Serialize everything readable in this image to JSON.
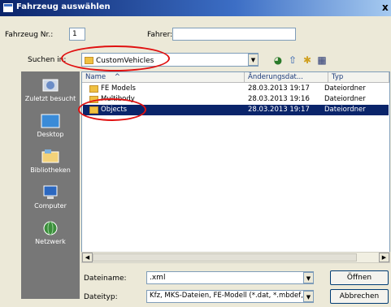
{
  "window": {
    "title": "Fahrzeug auswählen",
    "close_glyph": "x"
  },
  "form": {
    "vehicle_no_label": "Fahrzeug Nr.:",
    "vehicle_no_value": "1",
    "driver_label": "Fahrer:",
    "driver_value": "",
    "search_in_label": "Suchen in:",
    "search_in_value": "CustomVehicles"
  },
  "places": [
    {
      "label": "Zuletzt besucht",
      "icon": "recent-icon"
    },
    {
      "label": "Desktop",
      "icon": "desktop-icon"
    },
    {
      "label": "Bibliotheken",
      "icon": "libraries-icon"
    },
    {
      "label": "Computer",
      "icon": "computer-icon"
    },
    {
      "label": "Netzwerk",
      "icon": "network-icon"
    }
  ],
  "file_list": {
    "columns": [
      "Name",
      "Änderungsdat...",
      "Typ"
    ],
    "sort_glyph": "^",
    "rows": [
      {
        "name": "FE Models",
        "date": "28.03.2013 19:17",
        "type": "Dateiordner",
        "selected": false
      },
      {
        "name": "Multibody",
        "date": "28.03.2013 19:16",
        "type": "Dateiordner",
        "selected": false
      },
      {
        "name": "Objects",
        "date": "28.03.2013 19:17",
        "type": "Dateiordner",
        "selected": true
      }
    ]
  },
  "bottom": {
    "filename_label": "Dateiname:",
    "filename_value": ".xml",
    "filetype_label": "Dateityp:",
    "filetype_value": "Kfz, MKS-Dateien, FE-Modell (*.dat, *.mbdef, *.x",
    "open_button": "Öffnen",
    "cancel_button": "Abbrechen"
  },
  "colors": {
    "selection": "#0a246a",
    "annotation": "#e01010",
    "places_bg": "#777777"
  }
}
